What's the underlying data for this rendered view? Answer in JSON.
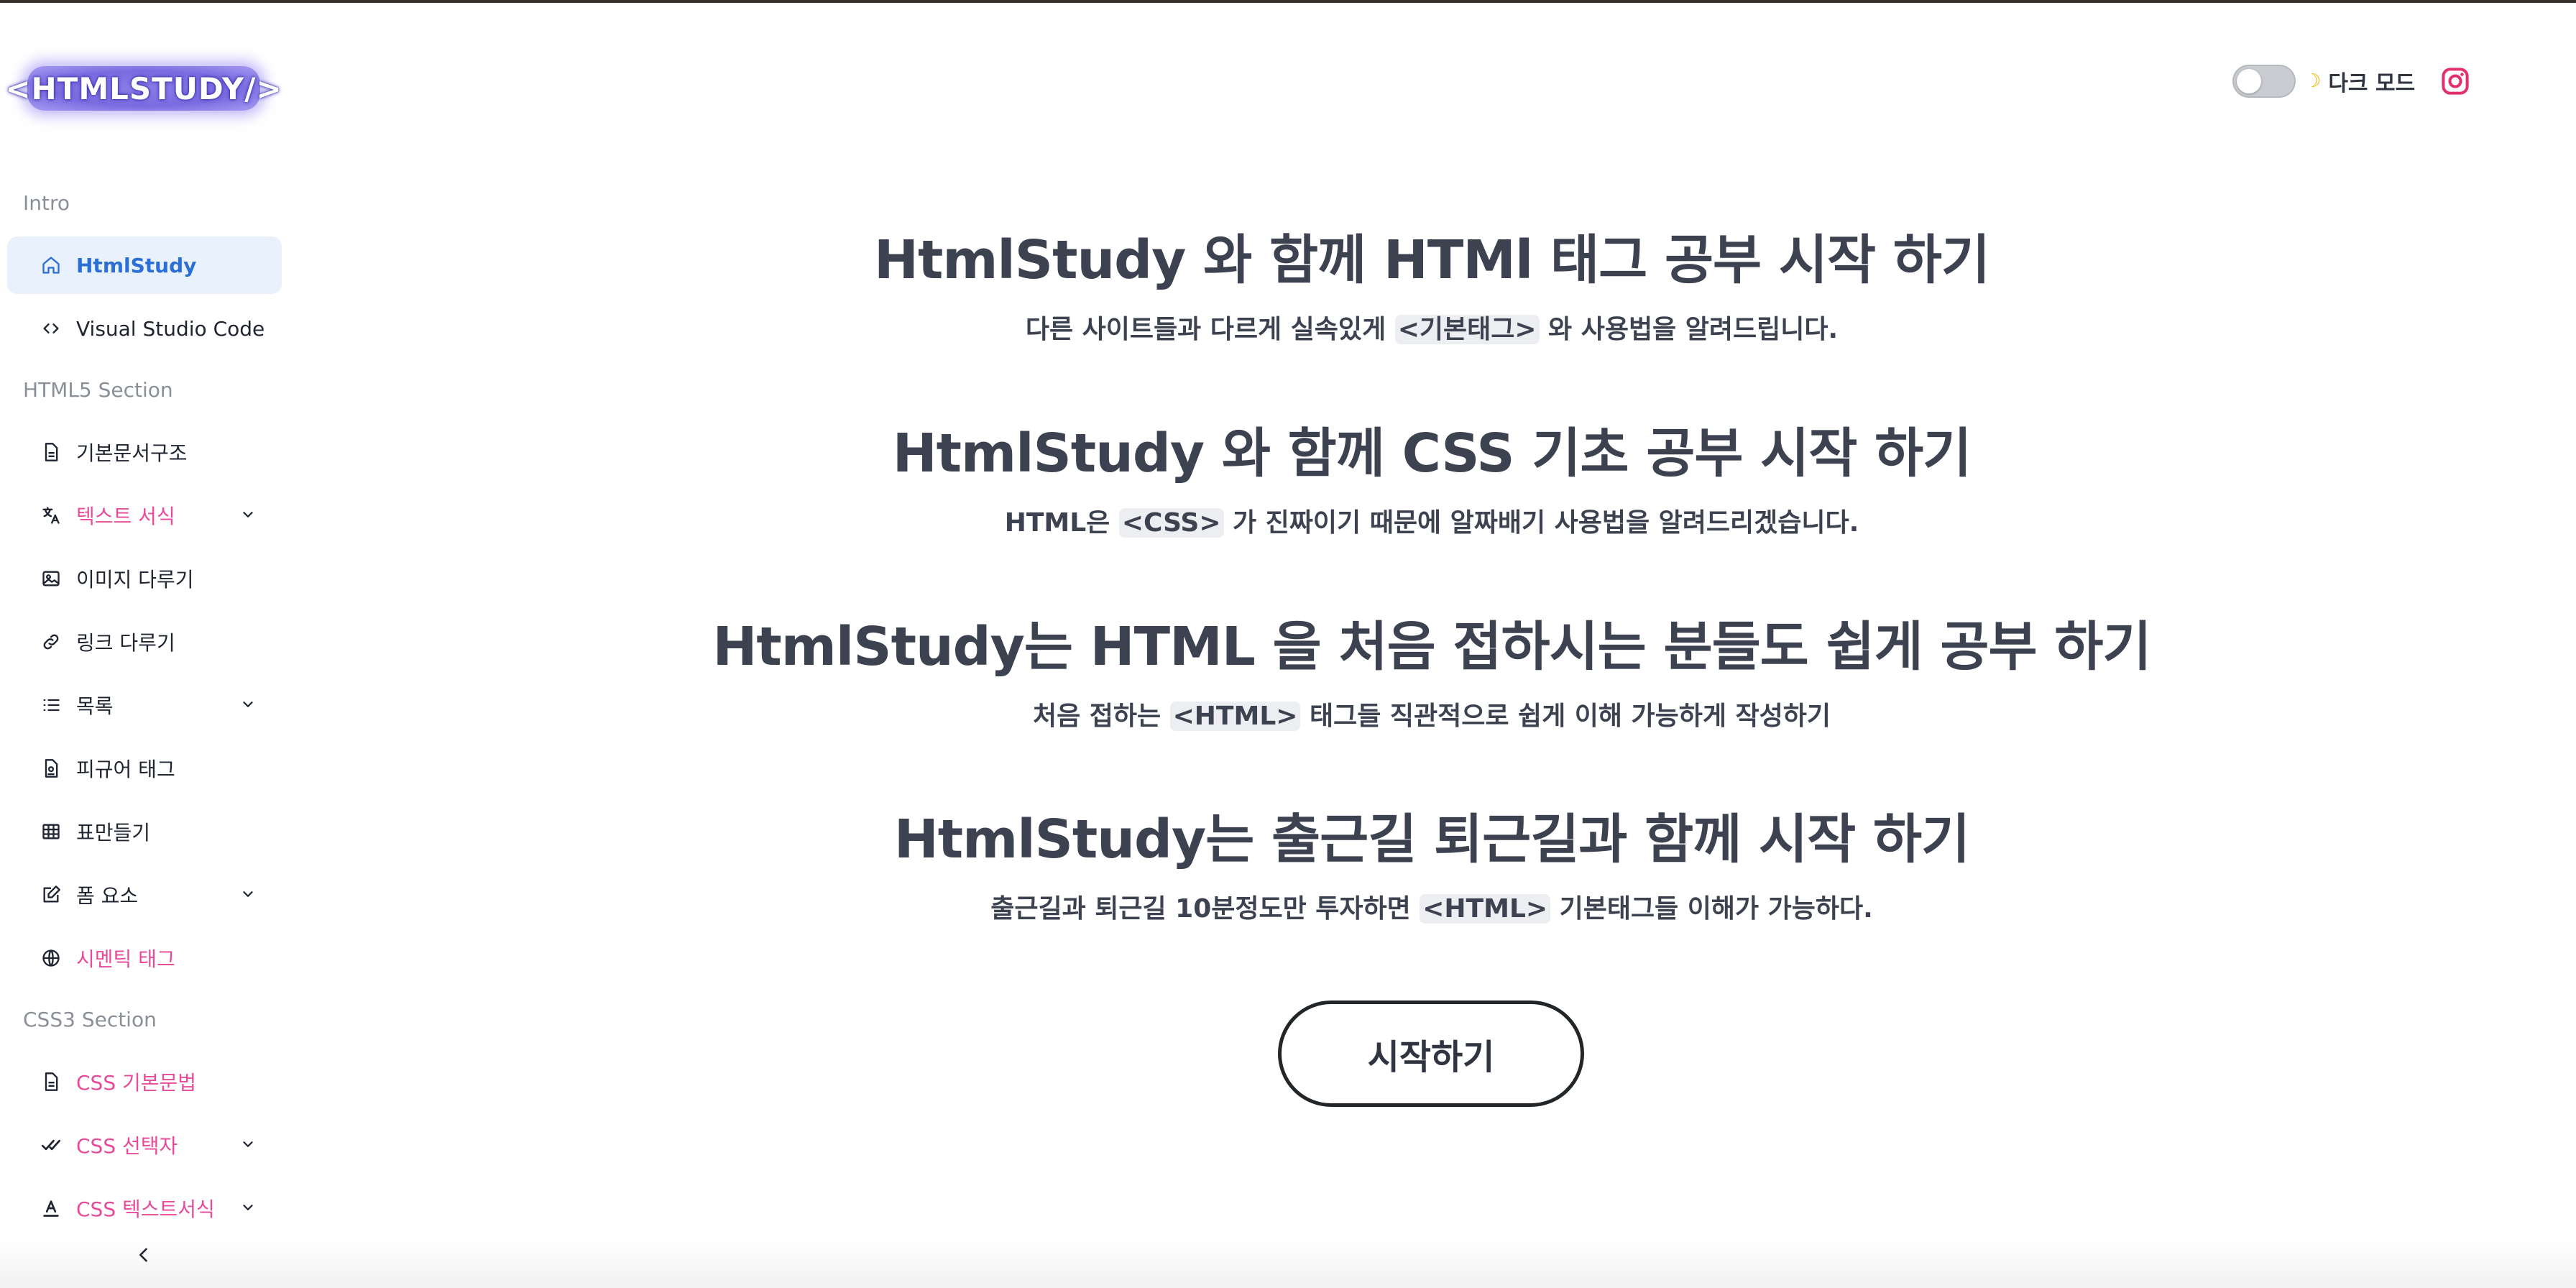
{
  "header": {
    "logo_text": "<HTMLSTUDY/>",
    "dark_mode_label": "다크 모드",
    "moon_symbol": "☽"
  },
  "sidebar": {
    "sections": [
      {
        "title": "Intro"
      },
      {
        "title": "HTML5 Section"
      },
      {
        "title": "CSS3 Section"
      }
    ],
    "items": [
      {
        "label": "HtmlStudy",
        "icon": "home-icon",
        "active": true
      },
      {
        "label": "Visual Studio Code",
        "icon": "code-icon"
      },
      {
        "label": "기본문서구조",
        "icon": "document-icon"
      },
      {
        "label": "텍스트 서식",
        "icon": "translate-icon",
        "expandable": true,
        "pink": true
      },
      {
        "label": "이미지 다루기",
        "icon": "image-icon"
      },
      {
        "label": "링크 다루기",
        "icon": "link-icon"
      },
      {
        "label": "목록",
        "icon": "list-icon",
        "expandable": true
      },
      {
        "label": "피규어 태그",
        "icon": "figure-icon"
      },
      {
        "label": "표만들기",
        "icon": "table-icon"
      },
      {
        "label": "폼 요소",
        "icon": "edit-icon",
        "expandable": true
      },
      {
        "label": "시멘틱 태그",
        "icon": "globe-icon",
        "pink": true
      },
      {
        "label": "CSS 기본문법",
        "icon": "document-icon",
        "pink": true
      },
      {
        "label": "CSS 선택자",
        "icon": "check-icon",
        "expandable": true,
        "pink": true
      },
      {
        "label": "CSS 텍스트서식",
        "icon": "text-format-icon",
        "expandable": true,
        "pink": true
      }
    ]
  },
  "main": {
    "blocks": [
      {
        "title": "HtmlStudy 와 함께 HTMl 태그 공부 시작 하기",
        "desc_before": "다른 사이트들과 다르게 실속있게 ",
        "code": "<기본태그>",
        "desc_after": " 와 사용법을 알려드립니다."
      },
      {
        "title": "HtmlStudy 와 함께 CSS 기초 공부 시작 하기",
        "desc_before": "HTML은 ",
        "code": "<CSS>",
        "desc_after": " 가 진짜이기 때문에 알짜배기 사용법을 알려드리겠습니다."
      },
      {
        "title": "HtmlStudy는 HTML 을 처음 접하시는 분들도 쉽게 공부 하기",
        "desc_before": "처음 접하는 ",
        "code": "<HTML>",
        "desc_after": " 태그들 직관적으로 쉽게 이해 가능하게 작성하기"
      },
      {
        "title": "HtmlStudy는 출근길 퇴근길과 함께 시작 하기",
        "desc_before": "출근길과 퇴근길 10분정도만 투자하면 ",
        "code": "<HTML>",
        "desc_after": " 기본태그들 이해가 가능하다."
      }
    ],
    "start_button": "시작하기"
  },
  "colors": {
    "active_bg": "#e8f1fc",
    "active_text": "#2b6fd6",
    "pink_text": "#e94b9a",
    "logo_purple": "#7a6be0",
    "instagram": "#e1306c"
  }
}
